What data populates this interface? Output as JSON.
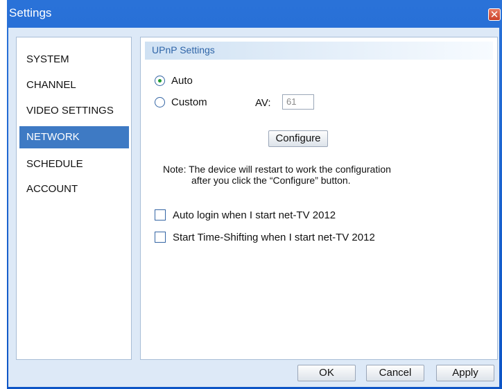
{
  "window": {
    "title": "Settings"
  },
  "sidebar": {
    "items": [
      {
        "label": "SYSTEM"
      },
      {
        "label": "CHANNEL"
      },
      {
        "label": "VIDEO SETTINGS"
      },
      {
        "label": "NETWORK",
        "active": true
      },
      {
        "label": "SCHEDULE"
      },
      {
        "label": "ACCOUNT"
      }
    ]
  },
  "main": {
    "section_title": "UPnP Settings",
    "mode": {
      "auto_label": "Auto",
      "custom_label": "Custom",
      "selected": "Auto"
    },
    "av": {
      "label": "AV:",
      "value": "61"
    },
    "configure_label": "Configure",
    "note_line1": "Note: The device will restart to work the configuration",
    "note_line2": "after you click the “Configure” button.",
    "options": [
      {
        "label": "Auto login when I start net-TV 2012",
        "checked": false
      },
      {
        "label": "Start Time-Shifting when I start net-TV 2012",
        "checked": false
      }
    ]
  },
  "footer": {
    "ok_label": "OK",
    "cancel_label": "Cancel",
    "apply_label": "Apply"
  }
}
